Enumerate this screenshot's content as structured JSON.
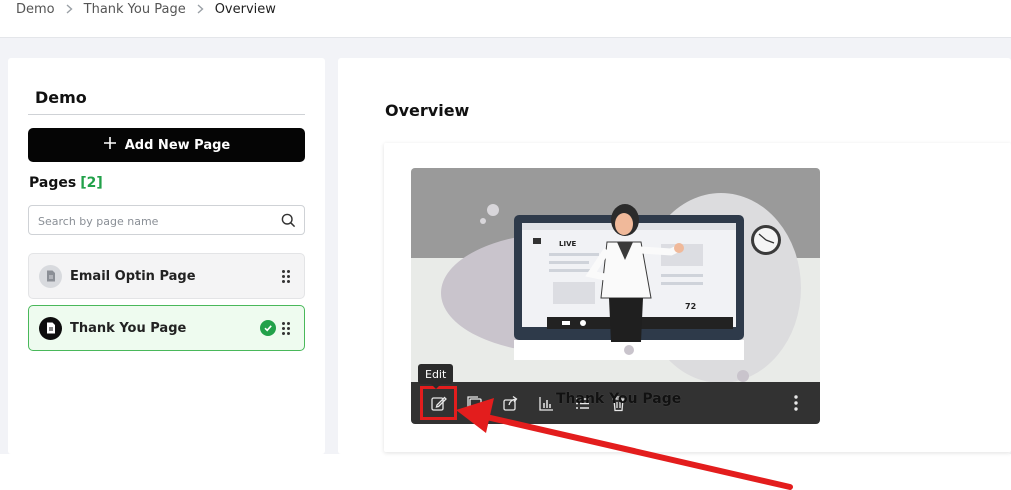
{
  "breadcrumb": {
    "items": [
      "Demo",
      "Thank You Page",
      "Overview"
    ]
  },
  "sidebar": {
    "title": "Demo",
    "add_button_label": "Add New Page",
    "pages_heading": "Pages",
    "pages_count": "[2]",
    "search_placeholder": "Search by page name",
    "pages": [
      {
        "label": "Email Optin Page",
        "active": false
      },
      {
        "label": "Thank You Page",
        "active": true
      }
    ]
  },
  "main": {
    "title": "Overview",
    "card": {
      "page_name": "Thank You Page",
      "tooltip": "Edit",
      "toolbar_icons": [
        "edit-icon",
        "duplicate-icon",
        "share-icon",
        "analytics-icon",
        "list-icon",
        "trash-icon",
        "more-vertical-icon"
      ],
      "illustration": {
        "live_label": "LIVE",
        "viewer_count": "72"
      }
    }
  },
  "colors": {
    "accent_green": "#22a14a",
    "annotation_red": "#e31d1d",
    "button_black": "#050505"
  }
}
